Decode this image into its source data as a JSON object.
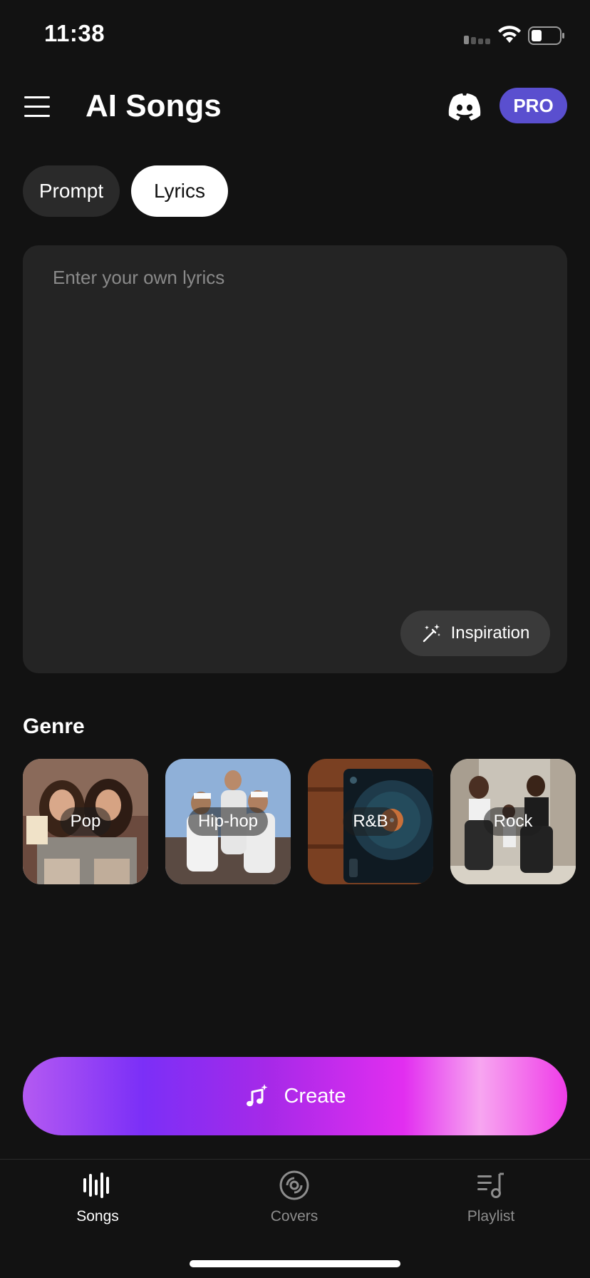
{
  "status_bar": {
    "time": "11:38"
  },
  "header": {
    "title": "AI Songs",
    "pro_label": "PRO"
  },
  "mode_tabs": [
    {
      "label": "Prompt",
      "active": false
    },
    {
      "label": "Lyrics",
      "active": true
    }
  ],
  "lyrics": {
    "value": "",
    "placeholder": "Enter your own lyrics",
    "inspiration_label": "Inspiration"
  },
  "genre": {
    "title": "Genre",
    "items": [
      {
        "label": "Pop",
        "selected": true
      },
      {
        "label": "Hip-hop",
        "selected": false
      },
      {
        "label": "R&B",
        "selected": false
      },
      {
        "label": "Rock",
        "selected": false
      }
    ]
  },
  "create": {
    "label": "Create"
  },
  "tab_bar": {
    "items": [
      {
        "label": "Songs",
        "icon": "waveform-icon",
        "active": true
      },
      {
        "label": "Covers",
        "icon": "disc-icon",
        "active": false
      },
      {
        "label": "Playlist",
        "icon": "playlist-icon",
        "active": false
      }
    ]
  },
  "colors": {
    "background": "#121212",
    "pro_badge": "#5a4fcf",
    "create_gradient": [
      "#b45af2",
      "#7b2ff7",
      "#e22ef0",
      "#ef3ce8"
    ]
  }
}
